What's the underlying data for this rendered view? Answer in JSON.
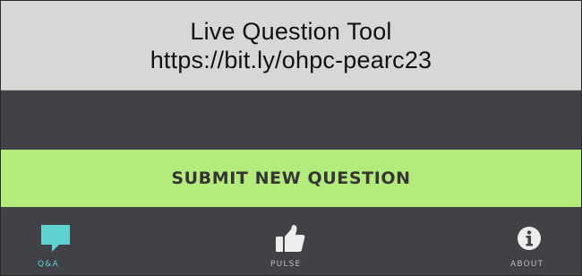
{
  "header": {
    "title": "Live Question Tool",
    "url": "https://bit.ly/ohpc-pearc23"
  },
  "actions": {
    "submit_label": "SUBMIT NEW QUESTION"
  },
  "tabs": [
    {
      "label": "Q&A",
      "icon": "speech-bubble-icon",
      "active": true
    },
    {
      "label": "PULSE",
      "icon": "thumbs-up-icon",
      "active": false
    },
    {
      "label": "ABOUT",
      "icon": "info-icon",
      "active": false
    }
  ],
  "colors": {
    "header_bg": "#d7d7d7",
    "dark_bg": "#404247",
    "button_bg": "#b4ec7c",
    "active_tab": "#5fd3d2",
    "inactive_tab": "#b9b9bd"
  }
}
